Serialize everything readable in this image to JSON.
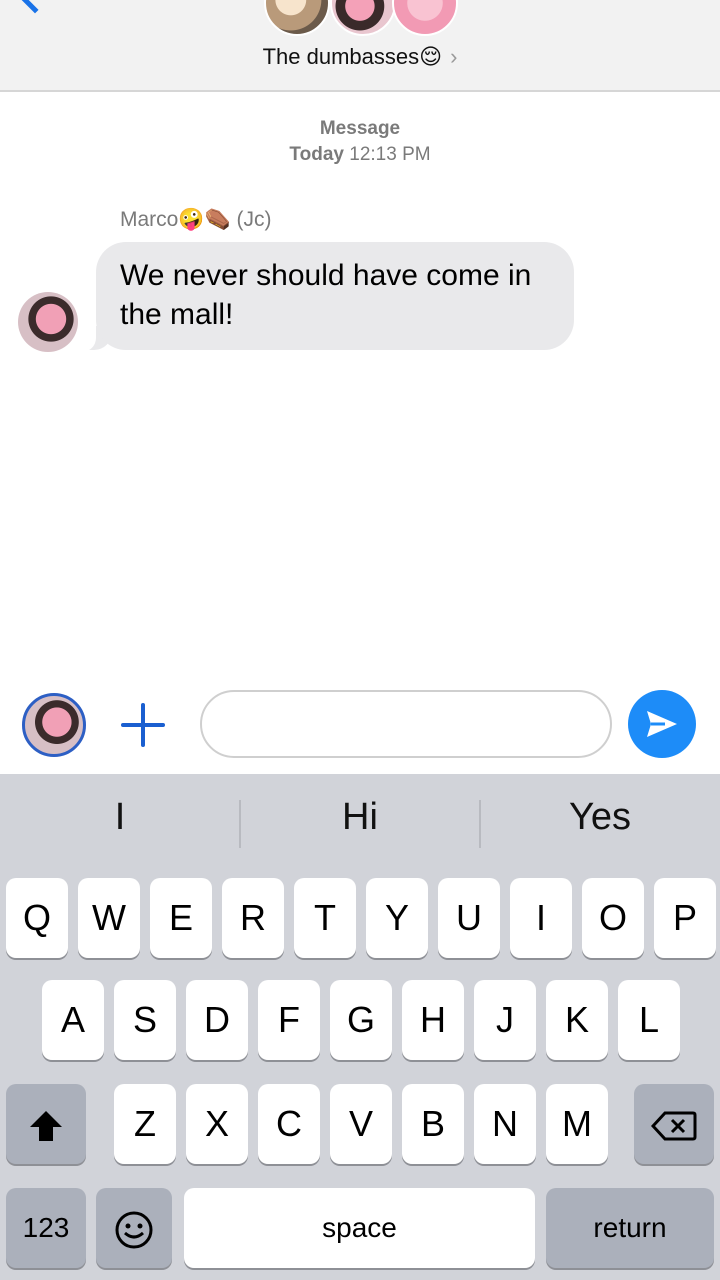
{
  "header": {
    "group_name": "The dumbasses😌",
    "chevron": "›"
  },
  "conversation": {
    "service_label": "Message",
    "day": "Today",
    "time": "12:13 PM",
    "messages": [
      {
        "sender": "Marco🤪⚰️ (Jc)",
        "text": "We never should have come in the mall!"
      }
    ]
  },
  "composer": {
    "value": "",
    "placeholder": ""
  },
  "keyboard": {
    "suggestions": [
      "I",
      "Hi",
      "Yes"
    ],
    "row1": [
      "Q",
      "W",
      "E",
      "R",
      "T",
      "Y",
      "U",
      "I",
      "O",
      "P"
    ],
    "row2": [
      "A",
      "S",
      "D",
      "F",
      "G",
      "H",
      "J",
      "K",
      "L"
    ],
    "row3": [
      "Z",
      "X",
      "C",
      "V",
      "B",
      "N",
      "M"
    ],
    "numbers_label": "123",
    "space_label": "space",
    "return_label": "return",
    "emoji_icon": "😐"
  },
  "colors": {
    "accent": "#1a73e8",
    "send": "#1d8cf8",
    "bubble": "#e9e9eb",
    "keyboard_bg": "#d1d3d9"
  }
}
